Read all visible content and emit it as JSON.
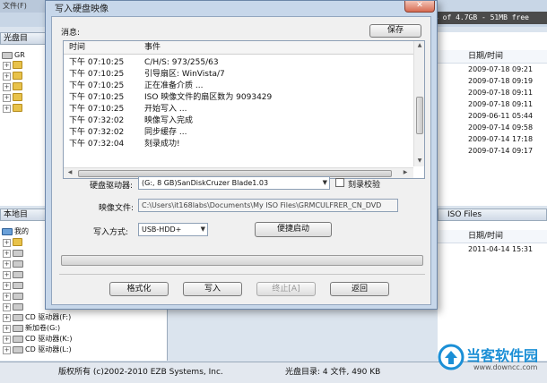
{
  "background_app": {
    "title_fragment": "文件(F)",
    "size_bar": "4 of 4.7GB - 51MB free",
    "optical_pane_title": "光盘目",
    "optical_tree": [
      "GR",
      "",
      "",
      "",
      "",
      ""
    ],
    "local_pane_title": "本地目",
    "local_tree": [
      "我的",
      "",
      "",
      "",
      "",
      "",
      "",
      "",
      "CD 驱动器(F:)",
      "新加卷(G:)",
      "CD 驱动器(K:)",
      "CD 驱动器(L:)"
    ],
    "right_header": "日期/时间",
    "right_dates": [
      "2009-07-18 09:21",
      "2009-07-18 09:19",
      "2009-07-18 09:11",
      "2009-07-18 09:11",
      "2009-06-11 05:44",
      "2009-07-14 09:58",
      "2009-07-14 17:18",
      "2009-07-14 09:17"
    ],
    "right_dir_header": "ISO Files",
    "right_header2": "日期/时间",
    "right_dates2": [
      "2011-04-14 15:31"
    ],
    "status_copyright": "版权所有 (c)2002-2010 EZB Systems, Inc.",
    "status_disc": "光盘目录: 4 文件, 490 KB"
  },
  "dialog": {
    "title": "写入硬盘映像",
    "close_label": "✕",
    "messages_label": "消息:",
    "save_button": "保存",
    "log_columns": {
      "time": "时间",
      "event": "事件"
    },
    "log_rows": [
      {
        "time": "下午 07:10:25",
        "event": "C/H/S: 973/255/63"
      },
      {
        "time": "下午 07:10:25",
        "event": "引导扇区: WinVista/7"
      },
      {
        "time": "下午 07:10:25",
        "event": "正在准备介质 ..."
      },
      {
        "time": "下午 07:10:25",
        "event": "ISO 映像文件的扇区数为 9093429"
      },
      {
        "time": "下午 07:10:25",
        "event": "开始写入 ..."
      },
      {
        "time": "下午 07:32:02",
        "event": "映像写入完成"
      },
      {
        "time": "下午 07:32:02",
        "event": "同步缓存 ..."
      },
      {
        "time": "下午 07:32:04",
        "event": "刻录成功!"
      }
    ],
    "drive_label": "硬盘驱动器:",
    "drive_value": "(G:, 8 GB)SanDiskCruzer Blade1.03",
    "verify_label": "刻录校验",
    "image_label": "映像文件:",
    "image_value": "C:\\Users\\it168labs\\Documents\\My ISO Files\\GRMCULFRER_CN_DVD",
    "method_label": "写入方式:",
    "method_value": "USB-HDD+",
    "boot_button": "便捷启动",
    "progress": 0,
    "buttons": {
      "format": "格式化",
      "write": "写入",
      "stop": "终止[A]",
      "back": "返回"
    }
  },
  "watermark": {
    "text": "当客软件园",
    "url": "www.downcc.com"
  },
  "colors": {
    "accent": "#3db34a",
    "title_bar": "#c7d7ea",
    "close": "#d76b52"
  }
}
